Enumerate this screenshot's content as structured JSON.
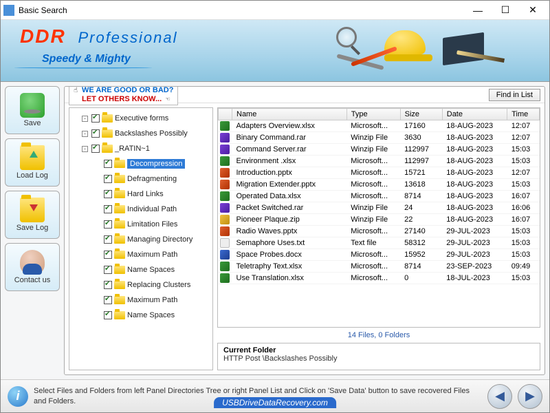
{
  "window": {
    "title": "Basic Search"
  },
  "banner": {
    "brand": "DDR",
    "product": "Professional",
    "tagline": "Speedy & Mighty"
  },
  "leftbar": {
    "save": "Save",
    "loadlog": "Load Log",
    "savelog": "Save Log",
    "contact": "Contact us"
  },
  "toprow": {
    "rating_l1": "WE ARE GOOD OR BAD?",
    "rating_l2": "LET OTHERS KNOW...",
    "find": "Find in List"
  },
  "tree": [
    {
      "label": "Executive forms",
      "depth": 0,
      "exp": "-",
      "sel": false
    },
    {
      "label": "Backslashes Possibly",
      "depth": 0,
      "exp": "-",
      "sel": false
    },
    {
      "label": "_RATIN~1",
      "depth": 0,
      "exp": "-",
      "sel": false
    },
    {
      "label": "Decompression",
      "depth": 1,
      "exp": "",
      "sel": true
    },
    {
      "label": "Defragmenting",
      "depth": 1,
      "exp": "",
      "sel": false
    },
    {
      "label": "Hard Links",
      "depth": 1,
      "exp": "",
      "sel": false
    },
    {
      "label": "Individual Path",
      "depth": 1,
      "exp": "",
      "sel": false
    },
    {
      "label": "Limitation Files",
      "depth": 1,
      "exp": "",
      "sel": false
    },
    {
      "label": "Managing Directory",
      "depth": 1,
      "exp": "",
      "sel": false
    },
    {
      "label": "Maximum Path",
      "depth": 1,
      "exp": "",
      "sel": false
    },
    {
      "label": "Name Spaces",
      "depth": 1,
      "exp": "",
      "sel": false
    },
    {
      "label": "Replacing Clusters",
      "depth": 1,
      "exp": "",
      "sel": false
    },
    {
      "label": "Maximum Path",
      "depth": 1,
      "exp": "",
      "sel": false
    },
    {
      "label": "Name Spaces",
      "depth": 1,
      "exp": "",
      "sel": false
    }
  ],
  "columns": {
    "name": "Name",
    "type": "Type",
    "size": "Size",
    "date": "Date",
    "time": "Time"
  },
  "files": [
    {
      "name": "Adapters Overview.xlsx",
      "type": "Microsoft...",
      "size": "17160",
      "date": "18-AUG-2023",
      "time": "12:07",
      "ico": "xlsx"
    },
    {
      "name": "Binary Command.rar",
      "type": "Winzip File",
      "size": "3630",
      "date": "18-AUG-2023",
      "time": "12:07",
      "ico": "rar"
    },
    {
      "name": "Command Server.rar",
      "type": "Winzip File",
      "size": "112997",
      "date": "18-AUG-2023",
      "time": "15:03",
      "ico": "rar"
    },
    {
      "name": "Environment .xlsx",
      "type": "Microsoft...",
      "size": "112997",
      "date": "18-AUG-2023",
      "time": "15:03",
      "ico": "xlsx"
    },
    {
      "name": "Introduction.pptx",
      "type": "Microsoft...",
      "size": "15721",
      "date": "18-AUG-2023",
      "time": "12:07",
      "ico": "pptx"
    },
    {
      "name": "Migration Extender.pptx",
      "type": "Microsoft...",
      "size": "13618",
      "date": "18-AUG-2023",
      "time": "15:03",
      "ico": "pptx"
    },
    {
      "name": "Operated Data.xlsx",
      "type": "Microsoft...",
      "size": "8714",
      "date": "18-AUG-2023",
      "time": "16:07",
      "ico": "xlsx"
    },
    {
      "name": "Packet Switched.rar",
      "type": "Winzip File",
      "size": "24",
      "date": "18-AUG-2023",
      "time": "16:06",
      "ico": "rar"
    },
    {
      "name": "Pioneer Plaque.zip",
      "type": "Winzip File",
      "size": "22",
      "date": "18-AUG-2023",
      "time": "16:07",
      "ico": "zip"
    },
    {
      "name": "Radio Waves.pptx",
      "type": "Microsoft...",
      "size": "27140",
      "date": "29-JUL-2023",
      "time": "15:03",
      "ico": "pptx"
    },
    {
      "name": "Semaphore Uses.txt",
      "type": "Text file",
      "size": "58312",
      "date": "29-JUL-2023",
      "time": "15:03",
      "ico": "txt"
    },
    {
      "name": "Space Probes.docx",
      "type": "Microsoft...",
      "size": "15952",
      "date": "29-JUL-2023",
      "time": "15:03",
      "ico": "docx"
    },
    {
      "name": "Teletraphy Text.xlsx",
      "type": "Microsoft...",
      "size": "8714",
      "date": "23-SEP-2023",
      "time": "09:49",
      "ico": "xlsx"
    },
    {
      "name": "Use Translation.xlsx",
      "type": "Microsoft...",
      "size": "0",
      "date": "18-JUL-2023",
      "time": "15:03",
      "ico": "xlsx"
    }
  ],
  "status": "14 Files, 0 Folders",
  "current_folder": {
    "title": "Current Folder",
    "path": "HTTP Post \\Backslashes Possibly"
  },
  "footer": {
    "msg": "Select Files and Folders from left Panel Directories Tree or right Panel List and Click on 'Save Data' button to save recovered Files and Folders.",
    "url": "USBDriveDataRecovery.com"
  }
}
